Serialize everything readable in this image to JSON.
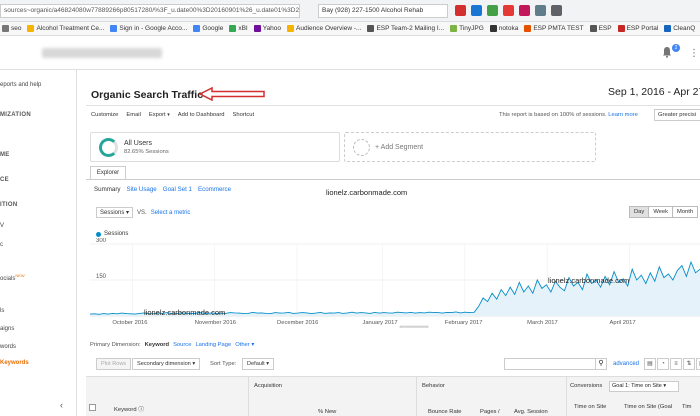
{
  "browser": {
    "url": "sources~organic/a46824080w77889266p80517280/%3F_u.date00%3D20160901%26_u.date01%3D20170427/",
    "search": "Bay (928) 227-1500 Alcohol Rehab",
    "ext_icons": [
      "red-dot",
      "s",
      "refresh",
      "heart",
      "pinterest",
      "down",
      "cast"
    ]
  },
  "bookmarks": [
    {
      "label": "seo",
      "color": "#777777"
    },
    {
      "label": "Alcohol Treatment Ce...",
      "color": "#f4b400"
    },
    {
      "label": "Sign in - Google Acco...",
      "color": "#4285f4"
    },
    {
      "label": "Google",
      "color": "#4285f4"
    },
    {
      "label": "xBI",
      "color": "#34a853"
    },
    {
      "label": "Yahoo",
      "color": "#720e9e"
    },
    {
      "label": "Audience Overview -...",
      "color": "#f4b400"
    },
    {
      "label": "ESP Team-2 Mailing I...",
      "color": "#555555"
    },
    {
      "label": "TinyJPG",
      "color": "#7cb342"
    },
    {
      "label": "notoka",
      "color": "#333333"
    },
    {
      "label": "ESP PMTA TEST",
      "color": "#e65100"
    },
    {
      "label": "ESP",
      "color": "#555555"
    },
    {
      "label": "ESP Portal",
      "color": "#c62828"
    },
    {
      "label": "CleanQ",
      "color": "#1565c0"
    }
  ],
  "header": {
    "bell_badge": "2"
  },
  "sidebar": {
    "items": [
      {
        "label": "eports and help",
        "section": false,
        "active": false,
        "new": false
      },
      {
        "label": "MIZATION",
        "section": true,
        "active": false,
        "new": false
      },
      {
        "label": "ME",
        "section": true,
        "active": false,
        "new": false
      },
      {
        "label": "CE",
        "section": true,
        "active": false,
        "new": false
      },
      {
        "label": "ITION",
        "section": true,
        "active": false,
        "new": false
      },
      {
        "label": "V",
        "section": false,
        "active": false,
        "new": false
      },
      {
        "label": "c",
        "section": false,
        "active": false,
        "new": false
      },
      {
        "label": "ocials",
        "section": false,
        "active": false,
        "new": true
      },
      {
        "label": "ls",
        "section": false,
        "active": false,
        "new": false
      },
      {
        "label": "aigns",
        "section": false,
        "active": false,
        "new": false
      },
      {
        "label": "words",
        "section": false,
        "active": false,
        "new": false
      },
      {
        "label": "Keywords",
        "section": false,
        "active": true,
        "new": false
      }
    ],
    "new_label": "NEW",
    "collapse": "‹"
  },
  "main": {
    "title": "Organic Search Traffic",
    "date_range": "Sep 1, 2016 - Apr 27,",
    "toolbar": [
      "Customize",
      "Email",
      "Export",
      "Add to Dashboard",
      "Shortcut"
    ],
    "sample_note_prefix": "This report is based on 100% of sessions.",
    "sample_note_link": "Learn more",
    "precision": "Greater precisi",
    "segment_name": "All Users",
    "segment_sub": "82.65% Sessions",
    "add_segment": "+ Add Segment",
    "explorer_tab": "Explorer",
    "subtabs": [
      "Summary",
      "Site Usage",
      "Goal Set 1",
      "Ecommerce"
    ],
    "watermark": "lionelz.carbonmade.com",
    "metric": "Sessions",
    "metric_vs": "VS.",
    "select_metric": "Select a metric",
    "periods": [
      "Day",
      "Week",
      "Month"
    ],
    "legend_label": "Sessions",
    "dimension_label": "Primary Dimension:",
    "dimension_current": "Keyword",
    "dimensions": [
      "Source",
      "Landing Page",
      "Other"
    ],
    "plot_rows": "Plot Rows",
    "secondary_dim": "Secondary dimension",
    "sort_type_label": "Sort Type:",
    "sort_type": "Default",
    "advanced": "advanced",
    "col_keyword": "Keyword",
    "col_acquisition": "Acquisition",
    "col_behavior": "Behavior",
    "col_conversions": "Conversions",
    "conv_goal": "Goal 1: Time on Site",
    "col_new": "% New",
    "col_bounce": "Bounce Rate",
    "col_pages": "Pages /",
    "col_duration": "Avg. Session",
    "col_tos1": "Time on Site",
    "col_tos2": "Time on Site (Goal",
    "col_tos3": "Tim"
  },
  "chart_data": {
    "type": "line",
    "title": "",
    "ylabel": "",
    "series": [
      {
        "name": "Sessions",
        "color": "#058dc7"
      }
    ],
    "yticks": [
      150,
      300
    ],
    "ylim": [
      0,
      300
    ],
    "xticks": [
      "October 2016",
      "November 2016",
      "December 2016",
      "January 2017",
      "February 2017",
      "March 2017",
      "April 2017"
    ],
    "grid": true,
    "values": [
      8,
      9,
      7,
      10,
      8,
      11,
      9,
      12,
      10,
      9,
      8,
      11,
      13,
      10,
      9,
      12,
      11,
      14,
      10,
      9,
      13,
      12,
      11,
      10,
      14,
      12,
      11,
      13,
      10,
      12,
      11,
      14,
      13,
      12,
      10,
      11,
      15,
      12,
      13,
      11,
      10,
      14,
      12,
      13,
      15,
      11,
      12,
      14,
      13,
      10,
      12,
      15,
      11,
      13,
      12,
      14,
      11,
      13,
      16,
      12,
      14,
      13,
      11,
      15,
      12,
      14,
      13,
      12,
      16,
      14,
      13,
      15,
      12,
      14,
      13,
      16,
      15,
      14,
      12,
      15,
      14,
      17,
      13,
      16,
      14,
      15,
      40,
      75,
      60,
      95,
      70,
      110,
      85,
      120,
      90,
      140,
      100,
      125,
      95,
      150,
      115,
      130,
      100,
      145,
      120,
      105,
      160,
      125,
      140,
      110,
      175,
      135,
      150,
      120,
      165,
      130,
      185,
      140,
      155,
      125,
      195,
      150,
      170,
      135,
      180,
      145,
      205,
      160,
      175,
      150,
      190,
      210,
      165,
      225,
      180,
      195
    ]
  }
}
